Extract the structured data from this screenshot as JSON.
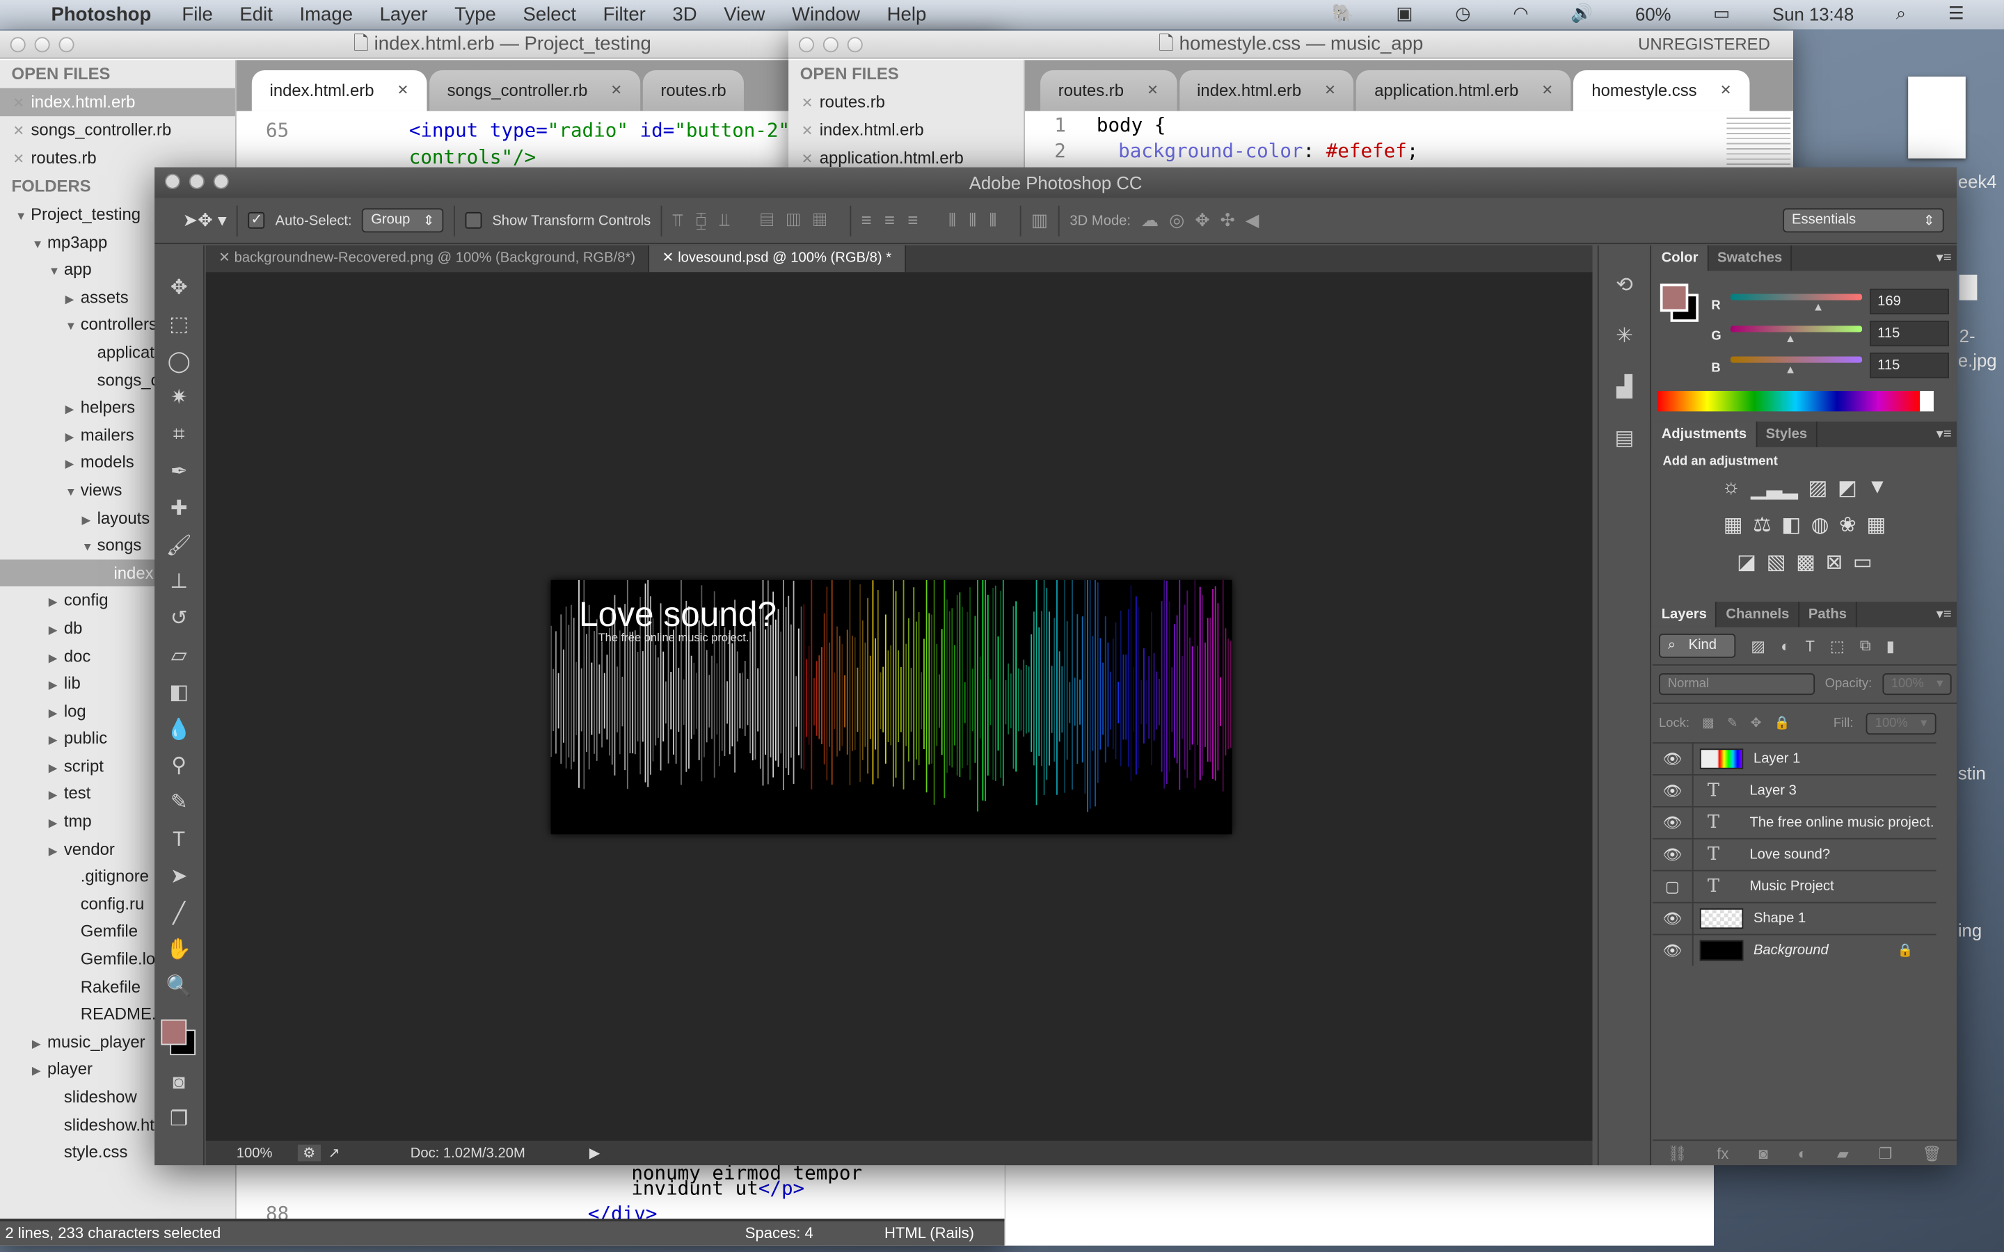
{
  "menubar": {
    "apple": "",
    "app": "Photoshop",
    "items": [
      "File",
      "Edit",
      "Image",
      "Layer",
      "Type",
      "Select",
      "Filter",
      "3D",
      "View",
      "Window",
      "Help"
    ],
    "battery": "60%",
    "clock": "Sun 13:48"
  },
  "sublime1": {
    "title": "index.html.erb — Project_testing",
    "open_files_header": "OPEN FILES",
    "open_files": [
      "index.html.erb",
      "songs_controller.rb",
      "routes.rb"
    ],
    "folders_header": "FOLDERS",
    "tabs": [
      "index.html.erb",
      "songs_controller.rb",
      "routes.rb"
    ],
    "tree": [
      {
        "label": "Project_testing",
        "level": 0,
        "arrow": "open"
      },
      {
        "label": "mp3app",
        "level": 1,
        "arrow": "open"
      },
      {
        "label": "app",
        "level": 2,
        "arrow": "open"
      },
      {
        "label": "assets",
        "level": 3,
        "arrow": "closed"
      },
      {
        "label": "controllers",
        "level": 3,
        "arrow": "open"
      },
      {
        "label": "application_controller.rb",
        "level": 4,
        "arrow": ""
      },
      {
        "label": "songs_controller.rb",
        "level": 4,
        "arrow": ""
      },
      {
        "label": "helpers",
        "level": 3,
        "arrow": "closed"
      },
      {
        "label": "mailers",
        "level": 3,
        "arrow": "closed"
      },
      {
        "label": "models",
        "level": 3,
        "arrow": "closed"
      },
      {
        "label": "views",
        "level": 3,
        "arrow": "open"
      },
      {
        "label": "layouts",
        "level": 4,
        "arrow": "closed"
      },
      {
        "label": "songs",
        "level": 4,
        "arrow": "open"
      },
      {
        "label": "index.html.erb",
        "level": 5,
        "arrow": "",
        "selected": true
      },
      {
        "label": "config",
        "level": 2,
        "arrow": "closed"
      },
      {
        "label": "db",
        "level": 2,
        "arrow": "closed"
      },
      {
        "label": "doc",
        "level": 2,
        "arrow": "closed"
      },
      {
        "label": "lib",
        "level": 2,
        "arrow": "closed"
      },
      {
        "label": "log",
        "level": 2,
        "arrow": "closed"
      },
      {
        "label": "public",
        "level": 2,
        "arrow": "closed"
      },
      {
        "label": "script",
        "level": 2,
        "arrow": "closed"
      },
      {
        "label": "test",
        "level": 2,
        "arrow": "closed"
      },
      {
        "label": "tmp",
        "level": 2,
        "arrow": "closed"
      },
      {
        "label": "vendor",
        "level": 2,
        "arrow": "closed"
      },
      {
        "label": ".gitignore",
        "level": 3,
        "arrow": ""
      },
      {
        "label": "config.ru",
        "level": 3,
        "arrow": ""
      },
      {
        "label": "Gemfile",
        "level": 3,
        "arrow": ""
      },
      {
        "label": "Gemfile.lock",
        "level": 3,
        "arrow": ""
      },
      {
        "label": "Rakefile",
        "level": 3,
        "arrow": ""
      },
      {
        "label": "README.rdoc",
        "level": 3,
        "arrow": ""
      },
      {
        "label": "music_player",
        "level": 1,
        "arrow": "closed"
      },
      {
        "label": "player",
        "level": 1,
        "arrow": "closed"
      },
      {
        "label": "slideshow",
        "level": 2,
        "arrow": ""
      },
      {
        "label": "slideshow.html",
        "level": 2,
        "arrow": ""
      },
      {
        "label": "style.css",
        "level": 2,
        "arrow": ""
      }
    ],
    "code": {
      "line65": "65",
      "line65_tag": "<input ",
      "line65_attr1": "type=",
      "line65_val1": "\"radio\" ",
      "line65_attr2": "id=",
      "line65_val2": "\"button-2\"",
      "line66": "controls\"/>",
      "frag1": "nonumy eirmod tempor",
      "frag2": "invidunt ut",
      "frag2_tag": "</p>",
      "line88": "88",
      "line88_tag": "</div>"
    },
    "status": {
      "selection": "2 lines, 233 characters selected",
      "spaces": "Spaces: 4",
      "syntax": "HTML (Rails)"
    }
  },
  "sublime2": {
    "title": "homestyle.css — music_app",
    "unregistered": "UNREGISTERED",
    "open_files_header": "OPEN FILES",
    "open_files": [
      "routes.rb",
      "index.html.erb",
      "application.html.erb"
    ],
    "tabs": [
      "routes.rb",
      "index.html.erb",
      "application.html.erb",
      "homestyle.css"
    ],
    "line1": "1",
    "line1_code": "body {",
    "line2": "2",
    "line2_prop": "background-color",
    "line2_val": "#efefef"
  },
  "photoshop": {
    "title": "Adobe Photoshop CC",
    "auto_select": "Auto-Select:",
    "auto_select_checked": true,
    "group": "Group",
    "show_transform": "Show Transform Controls",
    "show_transform_checked": false,
    "mode3d": "3D Mode:",
    "workspace": "Essentials",
    "doc_tabs": [
      "backgroundnew-Recovered.png @ 100% (Background, RGB/8*)",
      "lovesound.psd @ 100% (RGB/8) *"
    ],
    "zoom": "100%",
    "doc": "Doc: 1.02M/3.20M",
    "artwork": {
      "headline": "Love sound?",
      "tagline": "The free online music project."
    },
    "color_panel": {
      "tabs": [
        "Color",
        "Swatches"
      ],
      "r_label": "R",
      "g_label": "G",
      "b_label": "B",
      "r": "169",
      "g": "115",
      "b": "115",
      "foreground": "#a97373",
      "background": "#000000"
    },
    "adjustments": {
      "tabs": [
        "Adjustments",
        "Styles"
      ],
      "heading": "Add an adjustment"
    },
    "layers_panel": {
      "tabs": [
        "Layers",
        "Channels",
        "Paths"
      ],
      "kind": "Kind",
      "blend": "Normal",
      "opacity_label": "Opacity:",
      "opacity": "100%",
      "lock_label": "Lock:",
      "fill_label": "Fill:",
      "fill": "100%",
      "layers": [
        {
          "name": "Layer 1",
          "type": "pixel-rainbow",
          "visible": true
        },
        {
          "name": "Layer 3",
          "type": "text",
          "visible": true
        },
        {
          "name": "The free online music project.",
          "type": "text",
          "visible": true
        },
        {
          "name": "Love sound?",
          "type": "text",
          "visible": true
        },
        {
          "name": "Music Project",
          "type": "text",
          "visible": false
        },
        {
          "name": "Shape 1",
          "type": "shape",
          "visible": true
        },
        {
          "name": "Background",
          "type": "background",
          "visible": true,
          "locked": true
        }
      ]
    }
  },
  "desktop": {
    "labels": [
      "eek4",
      "2-",
      "e.jpg",
      "stin",
      "ing"
    ]
  }
}
